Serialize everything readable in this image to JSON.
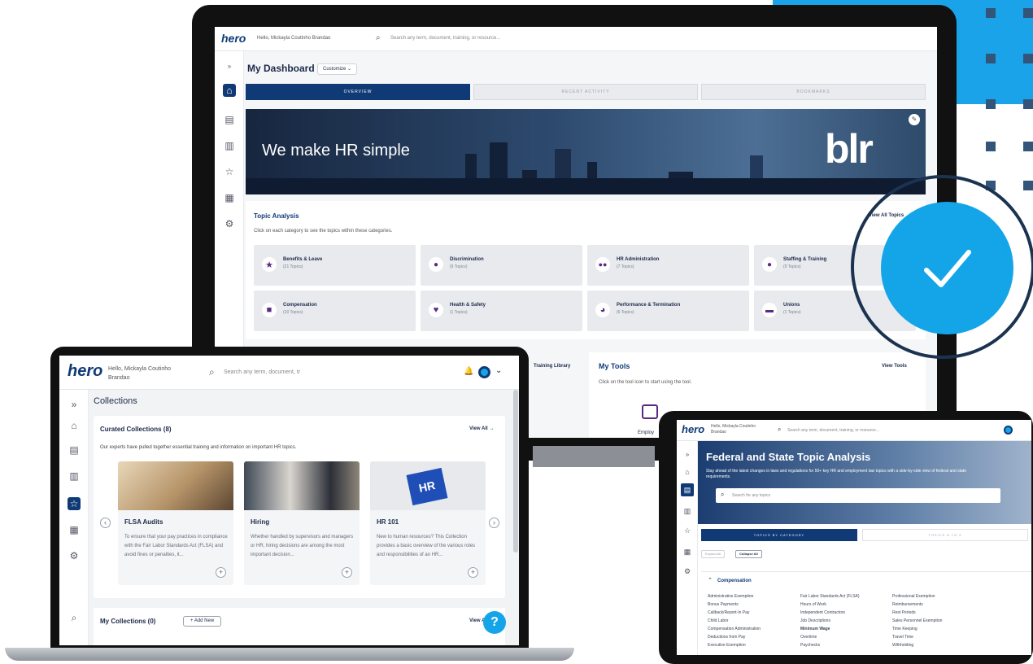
{
  "colors": {
    "navy": "#0f3a75",
    "brand_blue": "#14a5e9",
    "purple": "#5b2a86"
  },
  "monitor": {
    "greeting": "Hello, Mickayla Coutinho Brandao",
    "search_placeholder": "Search any term, document, training, or resource...",
    "page_title": "My Dashboard",
    "customize_label": "Customize",
    "tabs": [
      "OVERVIEW",
      "RECENT ACTIVITY",
      "BOOKMARKS"
    ],
    "banner_text": "We make HR simple",
    "brand_logo": "blr",
    "topic_heading": "Topic Analysis",
    "view_all_topics": "View All Topics",
    "topic_desc": "Click on each category to see the topics within these categories.",
    "topics": [
      {
        "title": "Benefits & Leave",
        "sub": "(21 Topics)"
      },
      {
        "title": "Discrimination",
        "sub": "(9 Topics)"
      },
      {
        "title": "HR Administration",
        "sub": "(7 Topics)"
      },
      {
        "title": "Staffing & Training",
        "sub": "(9 Topics)"
      },
      {
        "title": "Compensation",
        "sub": "(10 Topics)"
      },
      {
        "title": "Health & Safety",
        "sub": "(1 Topics)"
      },
      {
        "title": "Performance & Termination",
        "sub": "(6 Topics)"
      },
      {
        "title": "Unions",
        "sub": "(1 Topics)"
      }
    ],
    "training_link": "Training Library",
    "tools_heading": "My Tools",
    "view_tools": "View Tools",
    "tools_desc": "Click on the tool icon to start using the tool.",
    "tool_label": "Employ"
  },
  "laptop": {
    "logo": "hero",
    "greeting": "Hello, Mickayla Coutinho Brandao",
    "search_placeholder": "Search any term, document, tr",
    "page_title": "Collections",
    "curated_heading": "Curated Collections (8)",
    "view_all": "View All",
    "curated_desc": "Our experts have pulled together essential training and information on important HR topics.",
    "cards": [
      {
        "title": "FLSA Audits",
        "desc": "To ensure that your pay practices in compliance with the Fair Labor Standards Act (FLSA) and avoid fines or penalties, it..."
      },
      {
        "title": "Hiring",
        "desc": "Whether handled by supervisors and managers or HR, hiring decisions are among the most important decision..."
      },
      {
        "title": "HR 101",
        "desc": "New to human resources? This Collection provides a basic overview of the various roles and responsibilities of an HR..."
      }
    ],
    "hr_puzzle_text": "HR",
    "my_collections": "My Collections (0)",
    "add_new": "+ Add New",
    "view_all_short": "View A",
    "help": "?"
  },
  "tablet": {
    "logo": "hero",
    "greeting": "Hello, Mickayla Coutinho Brandao",
    "search_placeholder": "Search any term, document, training, or resource...",
    "title": "Federal and State Topic Analysis",
    "subtitle": "Stay ahead of the latest changes in laws and regulations for 50+ key HR and employment law topics with a side-by-side view of federal and state requirements.",
    "topics_search": "Search for any topics",
    "tab_active": "TOPICS BY CATEGORY",
    "tab_inactive": "TOPICS A TO Z",
    "expand_all": "Expand All",
    "collapse_all": "Collapse All",
    "section": "Compensation",
    "col1": [
      "Administrative Exemption",
      "Bonus Payments",
      "Callback/Report-In Pay",
      "Child Labor",
      "Compensation Administration",
      "Deductions from Pay",
      "Executive Exemption"
    ],
    "col2": [
      "Fair Labor Standards Act (FLSA)",
      "Hours of Work",
      "Independent Contractors",
      "Job Descriptions",
      "Minimum Wage",
      "Overtime",
      "Paychecks"
    ],
    "col3": [
      "Professional Exemption",
      "Reimbursements",
      "Rest Periods",
      "Sales Personnel Exemption",
      "Time Keeping",
      "Travel Time",
      "Withholding"
    ]
  }
}
